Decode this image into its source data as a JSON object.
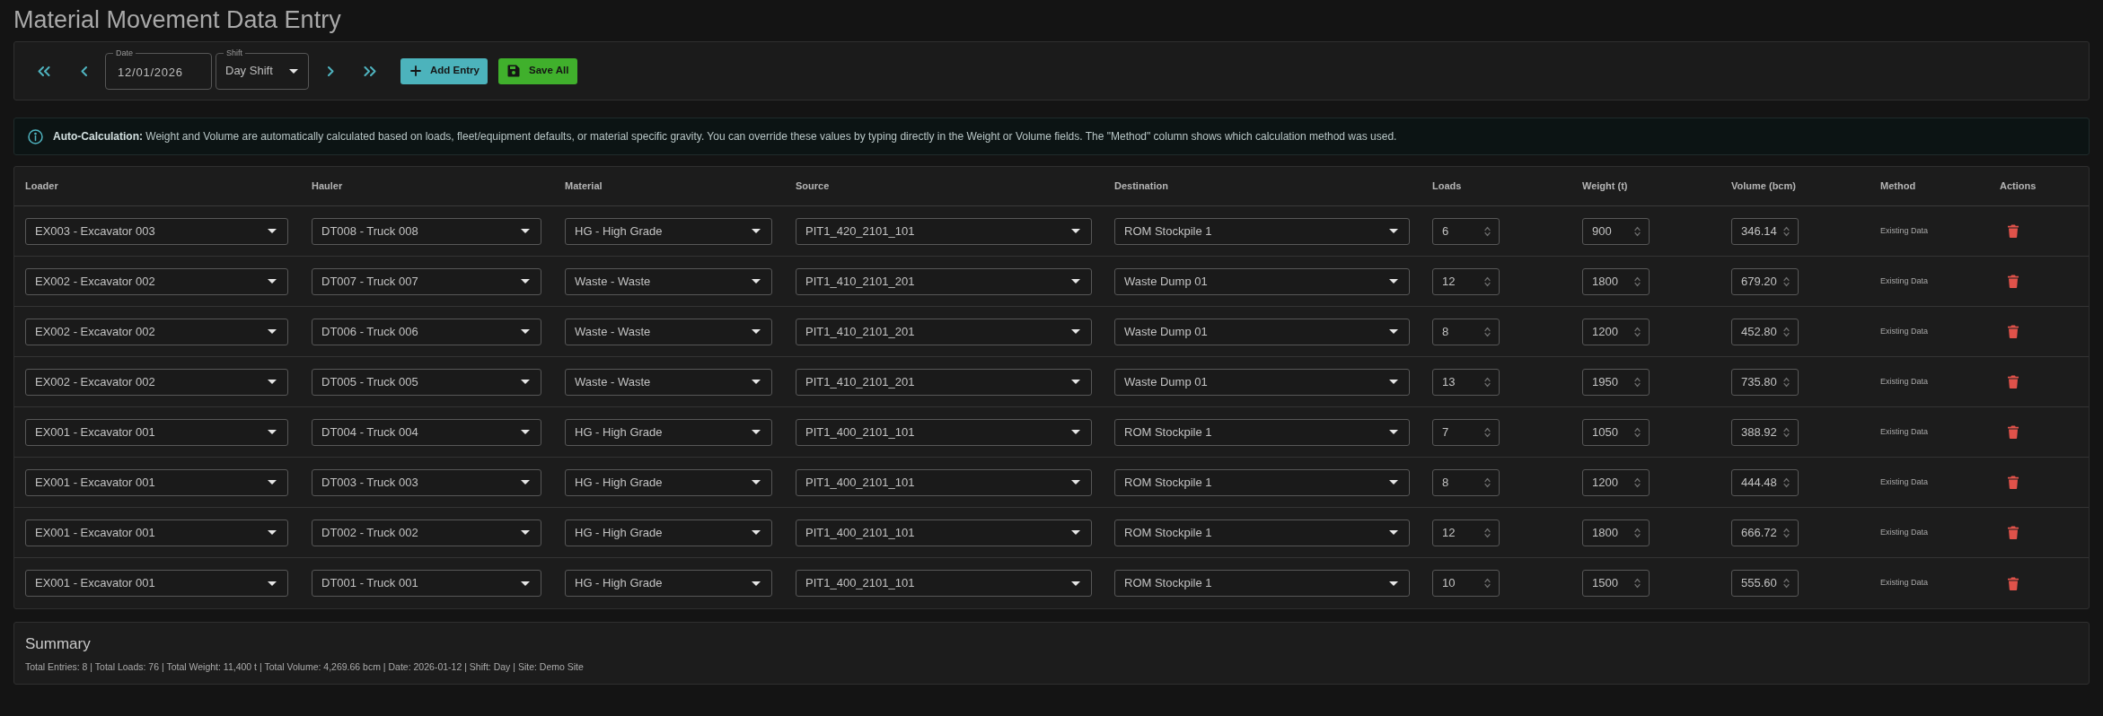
{
  "title": "Material Movement Data Entry",
  "toolbar": {
    "date": {
      "label": "Date",
      "value": "12/01/2026"
    },
    "shift": {
      "label": "Shift",
      "value": "Day Shift"
    },
    "buttons": [
      {
        "kind": "add",
        "label": "Add Entry"
      },
      {
        "kind": "save",
        "label": "Save All"
      }
    ]
  },
  "info_banner": {
    "text": "**Auto-Calculation:** Weight and Volume are automatically calculated based on loads, fleet/equipment defaults, or material specific gravity. You can override these values by typing directly in the Weight or Volume fields. The \"Method\" column shows which calculation method was used."
  },
  "table": {
    "columns": [
      "Loader",
      "Hauler",
      "Material",
      "Source",
      "Destination",
      "Loads",
      "Weight (t)",
      "Volume (bcm)",
      "Method",
      "Actions"
    ],
    "rows": [
      {
        "loader": "EX003 - Excavator 003",
        "hauler": "DT008 - Truck 008",
        "material": "HG - High Grade",
        "source": "PIT1_420_2101_101",
        "destination": "ROM Stockpile 1",
        "loads": "6",
        "weight": "900",
        "volume": "346.14",
        "method": "Existing Data"
      },
      {
        "loader": "EX002 - Excavator 002",
        "hauler": "DT007 - Truck 007",
        "material": "Waste - Waste",
        "source": "PIT1_410_2101_201",
        "destination": "Waste Dump 01",
        "loads": "12",
        "weight": "1800",
        "volume": "679.20",
        "method": "Existing Data"
      },
      {
        "loader": "EX002 - Excavator 002",
        "hauler": "DT006 - Truck 006",
        "material": "Waste - Waste",
        "source": "PIT1_410_2101_201",
        "destination": "Waste Dump 01",
        "loads": "8",
        "weight": "1200",
        "volume": "452.80",
        "method": "Existing Data"
      },
      {
        "loader": "EX002 - Excavator 002",
        "hauler": "DT005 - Truck 005",
        "material": "Waste - Waste",
        "source": "PIT1_410_2101_201",
        "destination": "Waste Dump 01",
        "loads": "13",
        "weight": "1950",
        "volume": "735.80",
        "method": "Existing Data"
      },
      {
        "loader": "EX001 - Excavator 001",
        "hauler": "DT004 - Truck 004",
        "material": "HG - High Grade",
        "source": "PIT1_400_2101_101",
        "destination": "ROM Stockpile 1",
        "loads": "7",
        "weight": "1050",
        "volume": "388.92",
        "method": "Existing Data"
      },
      {
        "loader": "EX001 - Excavator 001",
        "hauler": "DT003 - Truck 003",
        "material": "HG - High Grade",
        "source": "PIT1_400_2101_101",
        "destination": "ROM Stockpile 1",
        "loads": "8",
        "weight": "1200",
        "volume": "444.48",
        "method": "Existing Data"
      },
      {
        "loader": "EX001 - Excavator 001",
        "hauler": "DT002 - Truck 002",
        "material": "HG - High Grade",
        "source": "PIT1_400_2101_101",
        "destination": "ROM Stockpile 1",
        "loads": "12",
        "weight": "1800",
        "volume": "666.72",
        "method": "Existing Data"
      },
      {
        "loader": "EX001 - Excavator 001",
        "hauler": "DT001 - Truck 001",
        "material": "HG - High Grade",
        "source": "PIT1_400_2101_101",
        "destination": "ROM Stockpile 1",
        "loads": "10",
        "weight": "1500",
        "volume": "555.60",
        "method": "Existing Data"
      }
    ]
  },
  "summary": {
    "title": "Summary",
    "text": "Total Entries: 8 | Total Loads: 76 | Total Weight: 11,400 t | Total Volume: 4,269.66 bcm | Date: 2026-01-12 | Shift: Day | Site: Demo Site"
  }
}
